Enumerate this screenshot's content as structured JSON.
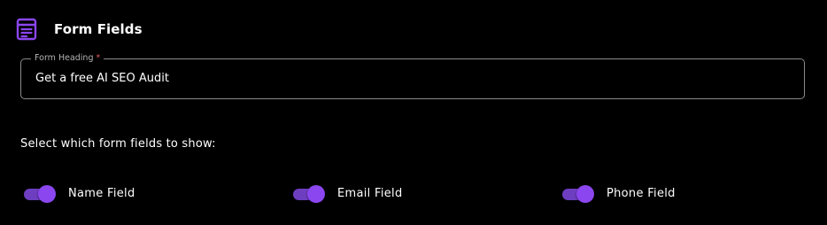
{
  "header": {
    "title": "Form Fields",
    "icon": "list-form-icon"
  },
  "form_heading": {
    "label": "Form Heading",
    "required_mark": "*",
    "value": "Get a free AI SEO Audit"
  },
  "fields_section": {
    "label": "Select which form fields to show:",
    "toggles": [
      {
        "label": "Name Field",
        "on": true
      },
      {
        "label": "Email Field",
        "on": true
      },
      {
        "label": "Phone Field",
        "on": true
      }
    ]
  },
  "colors": {
    "accent": "#8b46f0",
    "accent_track": "#6e3ec0",
    "background": "#000000"
  }
}
